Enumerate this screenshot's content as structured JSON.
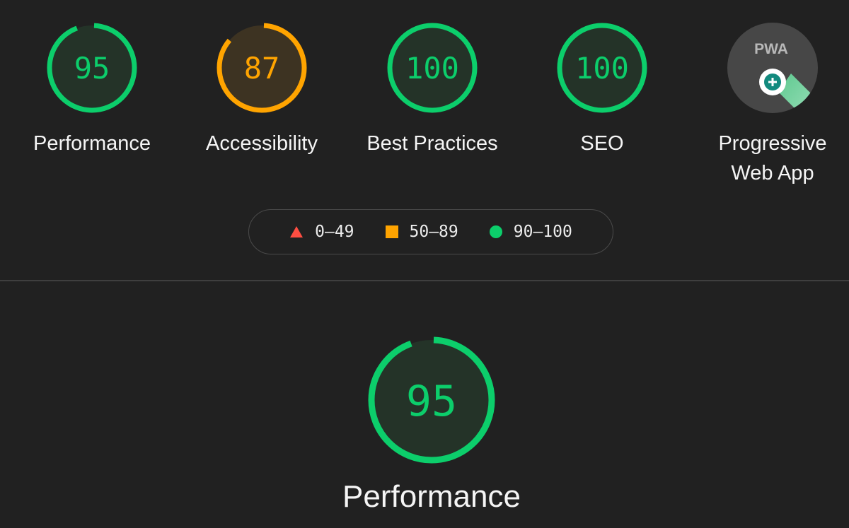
{
  "colors": {
    "pass": "#0cce6b",
    "average": "#ffa400",
    "fail": "#ff4e42",
    "pass_fill": "#243328",
    "average_fill": "#3d3322",
    "background": "#212121"
  },
  "categories": [
    {
      "id": "performance",
      "score": 95,
      "score_text": "95",
      "label": "Performance",
      "rating": "pass"
    },
    {
      "id": "accessibility",
      "score": 87,
      "score_text": "87",
      "label": "Accessibility",
      "rating": "average"
    },
    {
      "id": "best-practices",
      "score": 100,
      "score_text": "100",
      "label": "Best Practices",
      "rating": "pass"
    },
    {
      "id": "seo",
      "score": 100,
      "score_text": "100",
      "label": "SEO",
      "rating": "pass"
    }
  ],
  "pwa": {
    "badge_text": "PWA",
    "label_line1": "Progressive",
    "label_line2": "Web App",
    "icon": "pwa-badge-icon"
  },
  "legend": {
    "fail_range": "0–49",
    "average_range": "50–89",
    "pass_range": "90–100"
  },
  "detail": {
    "score": 95,
    "score_text": "95",
    "label": "Performance"
  }
}
